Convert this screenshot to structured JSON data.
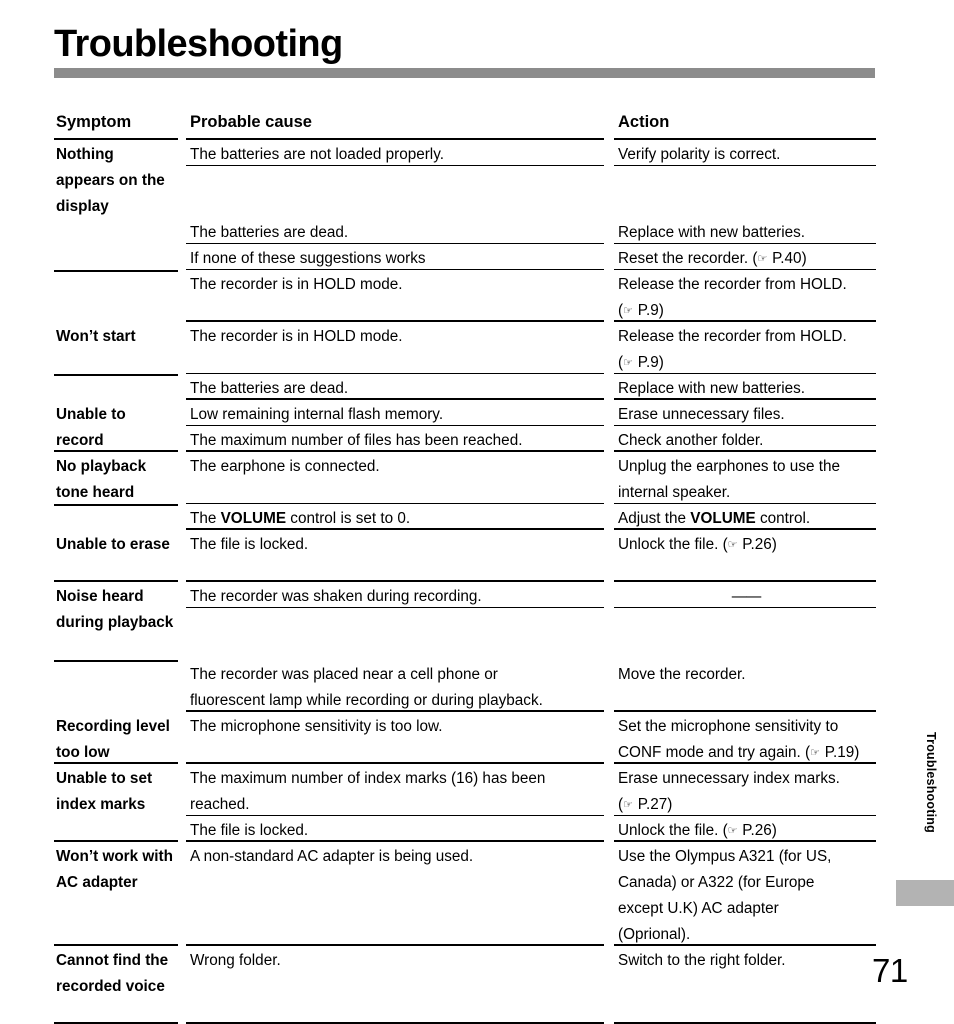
{
  "page": {
    "title": "Troubleshooting",
    "side_label": "Troubleshooting",
    "number": "71",
    "rule_color": "#8c8c8c",
    "tab_color": "#b3b3b3"
  },
  "table": {
    "headers": {
      "symptom": "Symptom",
      "cause": "Probable cause",
      "action": "Action"
    },
    "rows": [
      {
        "symptom": "Nothing appears on the display",
        "cause": "The batteries are not loaded properly.",
        "action": "Verify polarity is correct."
      },
      {
        "symptom": "",
        "cause": "The batteries are dead.",
        "action": "Replace with new batteries."
      },
      {
        "symptom": "",
        "cause": "If none of these suggestions works",
        "action_pre": "Reset the recorder. (",
        "action_ref": "P.40",
        "action_post": ")"
      },
      {
        "symptom": "",
        "cause": "The recorder is in HOLD mode.",
        "action_line1": "Release the recorder from HOLD.",
        "action_pre": "(",
        "action_ref": "P.9",
        "action_post": ")"
      },
      {
        "symptom": "Won’t start",
        "cause": "The recorder is in HOLD mode.",
        "action_line1": "Release the recorder from HOLD.",
        "action_pre": "(",
        "action_ref": "P.9",
        "action_post": ")"
      },
      {
        "symptom": "",
        "cause": "The batteries are dead.",
        "action": "Replace with new batteries."
      },
      {
        "symptom": "Unable to record",
        "cause": "Low remaining internal flash memory.",
        "action": "Erase unnecessary files."
      },
      {
        "symptom": "",
        "cause": "The maximum number of files has been reached.",
        "action": "Check another folder."
      },
      {
        "symptom": "No playback tone heard",
        "cause": "The earphone is connected.",
        "action_line1": "Unplug the earphones to use the",
        "action_line2": "internal speaker."
      },
      {
        "symptom": "",
        "cause_pre": "The ",
        "cause_bold": "VOLUME",
        "cause_post": " control is set to 0.",
        "action_pre2": "Adjust the ",
        "action_bold": "VOLUME",
        "action_post2": " control."
      },
      {
        "symptom": "Unable to erase",
        "cause": "The file is locked.",
        "action_pre": "Unlock the file. (",
        "action_ref": "P.26",
        "action_post": ")"
      },
      {
        "symptom": "Noise heard during playback",
        "cause": "The recorder was shaken during recording.",
        "action_dash": "——"
      },
      {
        "symptom": "",
        "cause_line1": "The recorder was placed near a cell phone or",
        "cause_line2": "fluorescent lamp while recording or during playback.",
        "action": "Move the recorder."
      },
      {
        "symptom": "Recording level too low",
        "cause": "The microphone sensitivity is too low.",
        "action_line1": "Set  the  microphone  sensitivity  to",
        "action_pre": "CONF mode and try again. (",
        "action_ref": "P.19",
        "action_post": ")"
      },
      {
        "symptom": "Unable to set index marks",
        "cause_line1": "The maximum number of index marks (16) has been",
        "cause_line2": "reached.",
        "action_line1": "Erase unnecessary index marks.",
        "action_pre": "(",
        "action_ref": "P.27",
        "action_post": ")"
      },
      {
        "symptom": "",
        "cause": "The file is locked.",
        "action_pre": "Unlock the file.  (",
        "action_ref": "P.26",
        "action_post": ")"
      },
      {
        "symptom": "Won’t work with AC adapter",
        "cause": "A non-standard AC adapter is being used.",
        "action_line1": "Use the Olympus A321 (for US,",
        "action_line2": "Canada) or A322 (for Europe",
        "action_line3": "except U.K) AC adapter",
        "action_line4": "(Oprional)."
      },
      {
        "symptom": "Cannot find the recorded voice",
        "cause": "Wrong folder.",
        "action": "Switch to the right folder."
      }
    ],
    "icons": {
      "page_ref_icon": "☞"
    }
  }
}
